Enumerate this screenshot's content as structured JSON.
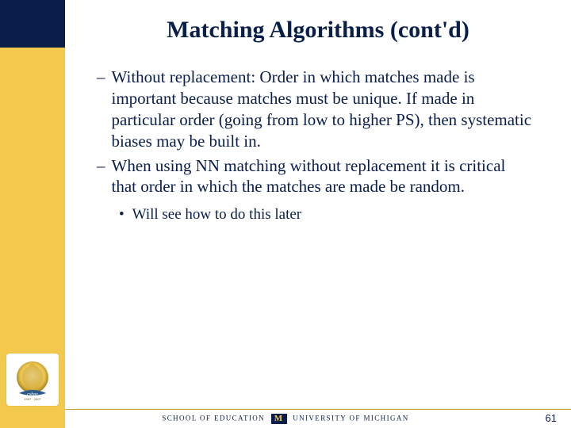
{
  "title": "Matching Algorithms (cont'd)",
  "bullets": {
    "b1": "Without replacement: Order in which matches made is important because matches must be unique. If made in particular order (going from low to higher PS), then systematic biases may be built in.",
    "b2": "When using NN matching without replacement it is critical that order in which the matches are made be random.",
    "sub1": "Will see how to do this later"
  },
  "footer": {
    "left": "SCHOOL OF EDUCATION",
    "m": "M",
    "right": "UNIVERSITY OF MICHIGAN"
  },
  "page_number": "61",
  "sidebar": {
    "logo_name": "cshpe-anniversary-logo"
  }
}
